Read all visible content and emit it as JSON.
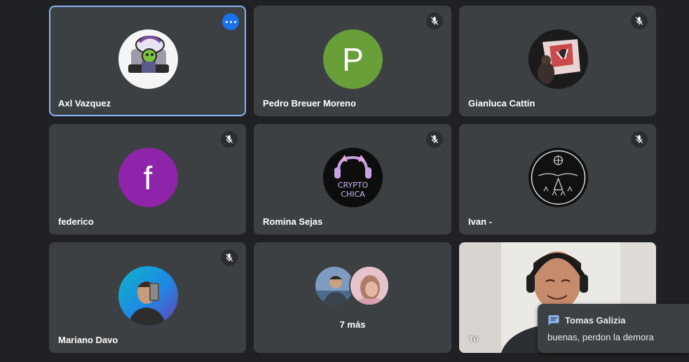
{
  "participants": [
    {
      "name": "Axl Vazquez",
      "avatar_type": "image",
      "muted": false,
      "active": true
    },
    {
      "name": "Pedro Breuer Moreno",
      "avatar_type": "letter",
      "letter": "P",
      "color": "#689f38",
      "muted": true
    },
    {
      "name": "Gianluca Cattin",
      "avatar_type": "image",
      "muted": true
    },
    {
      "name": "federico",
      "avatar_type": "letter",
      "letter": "f",
      "color": "#8e24aa",
      "muted": true
    },
    {
      "name": "Romina Sejas",
      "avatar_type": "image",
      "avatar_text_line1": "CRYPTO",
      "avatar_text_line2": "CHICA",
      "muted": true
    },
    {
      "name": "Ivan -",
      "avatar_type": "image",
      "muted": true
    },
    {
      "name": "Mariano Davo",
      "avatar_type": "image",
      "muted": true
    }
  ],
  "overflow": {
    "label": "7 más"
  },
  "self_tile": {
    "label": "Tú"
  },
  "chat_toast": {
    "sender": "Tomas Galizia",
    "message": "buenas, perdon la demora"
  },
  "colors": {
    "background": "#202124",
    "tile": "#3c4043",
    "accent": "#1a73e8",
    "active_border": "#8ab4f8",
    "chat_icon": "#8ab4f8"
  }
}
